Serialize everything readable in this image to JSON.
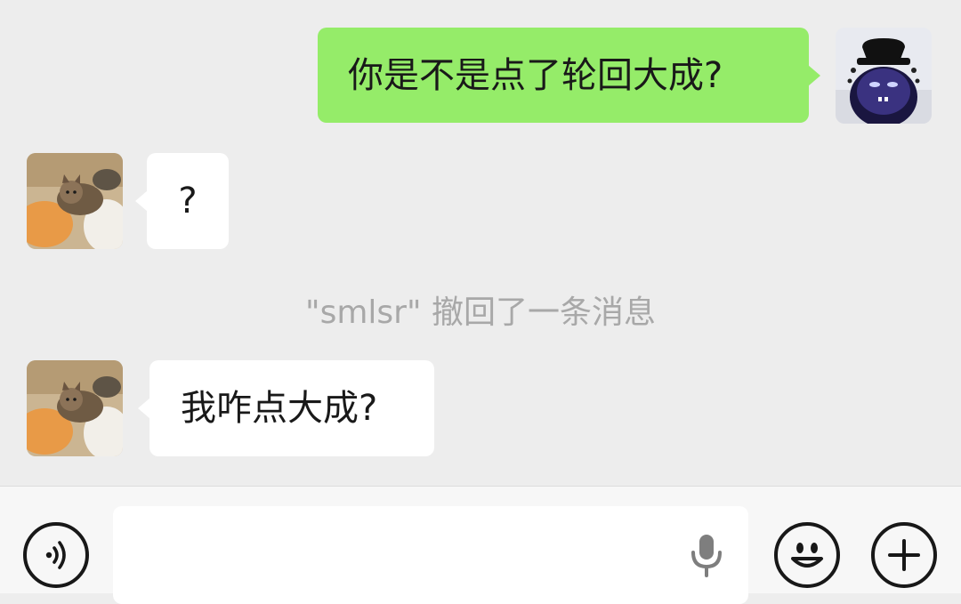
{
  "messages": [
    {
      "side": "me",
      "text": "你是不是点了轮回大成?",
      "avatar": "purple-blob-top-hat-avatar"
    },
    {
      "side": "them",
      "text": "?",
      "avatar": "cat-photo-avatar"
    },
    {
      "side": "system",
      "text": "\"smlsr\" 撤回了一条消息"
    },
    {
      "side": "them",
      "text": "我咋点大成?",
      "avatar": "cat-photo-avatar"
    }
  ],
  "input_bar": {
    "voice_icon": "voice-mode-icon",
    "text_value": "",
    "mic_icon": "microphone-icon",
    "emoji_icon": "emoji-icon",
    "plus_icon": "plus-icon"
  },
  "colors": {
    "background": "#ededed",
    "my_bubble": "#95ec69",
    "their_bubble": "#ffffff",
    "system_text": "#a8a8a8",
    "input_bar": "#f7f7f7"
  }
}
